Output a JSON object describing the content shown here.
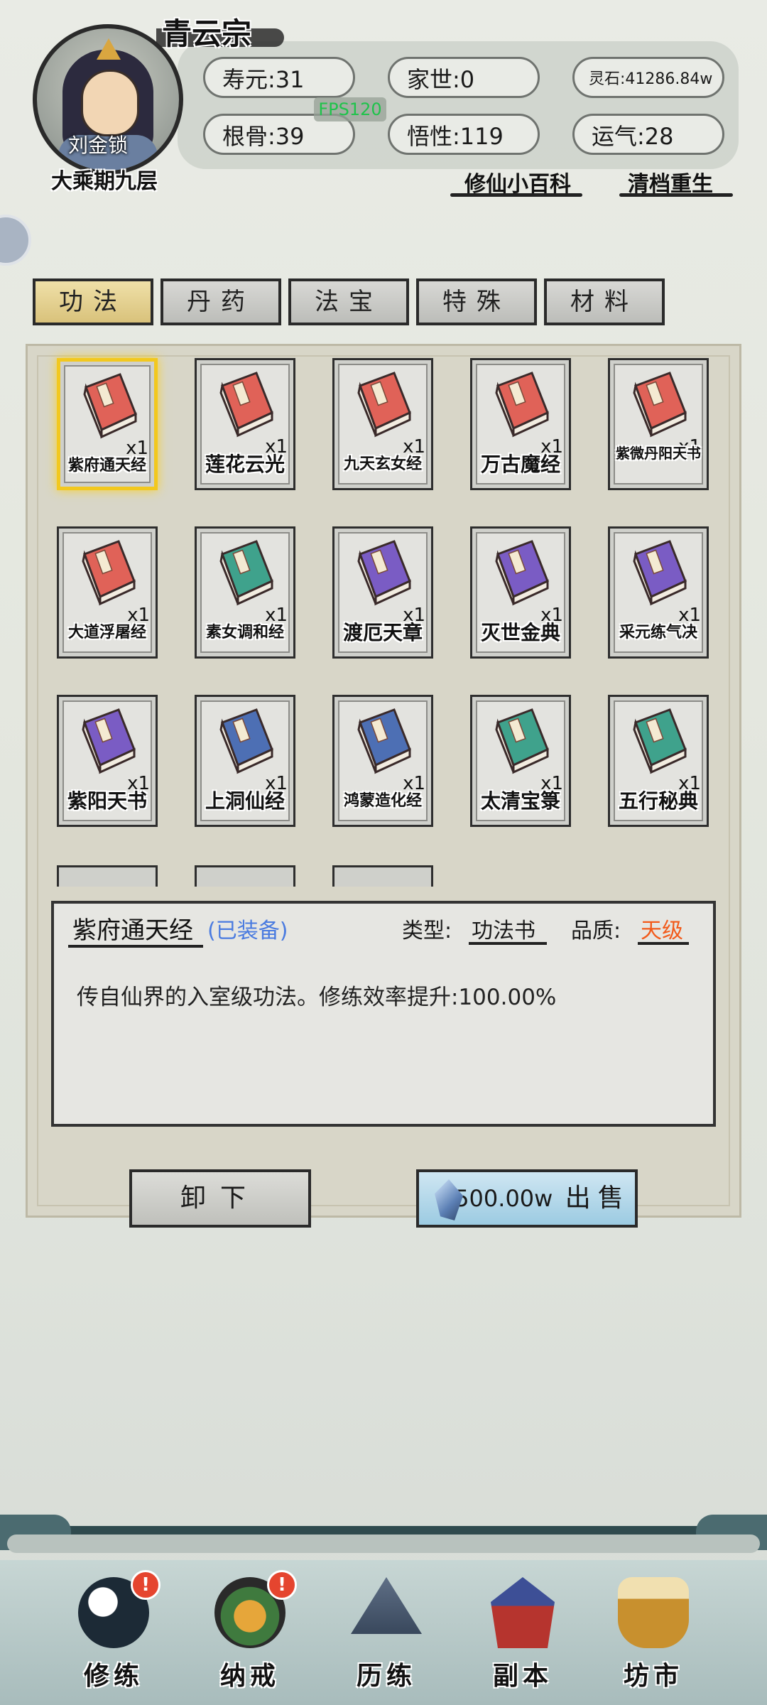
{
  "header": {
    "sect": "青云宗",
    "character": {
      "name": "刘金锁",
      "rank": "大乘期九层"
    },
    "stats": [
      {
        "label": "寿元:",
        "value": "31"
      },
      {
        "label": "家世:",
        "value": "0"
      },
      {
        "label": "灵石:",
        "value": "41286.84w"
      },
      {
        "label": "根骨:",
        "value": "39"
      },
      {
        "label": "悟性:",
        "value": "119"
      },
      {
        "label": "运气:",
        "value": "28"
      }
    ],
    "fps": "FPS120",
    "links": {
      "encyclopedia": "修仙小百科",
      "reset": "清档重生"
    }
  },
  "tabs": [
    "功法",
    "丹药",
    "法宝",
    "特殊",
    "材料"
  ],
  "items": [
    {
      "name": "紫府通天经",
      "qty": "x1",
      "color": "#e06258"
    },
    {
      "name": "莲花云光",
      "qty": "x1",
      "color": "#e06258"
    },
    {
      "name": "九天玄女经",
      "qty": "x1",
      "color": "#e06258"
    },
    {
      "name": "万古魔经",
      "qty": "x1",
      "color": "#e06258"
    },
    {
      "name": "紫微丹阳天书",
      "qty": "x1",
      "color": "#e06258"
    },
    {
      "name": "大道浮屠经",
      "qty": "x1",
      "color": "#e06258"
    },
    {
      "name": "素女调和经",
      "qty": "x1",
      "color": "#3fa28c"
    },
    {
      "name": "渡厄天章",
      "qty": "x1",
      "color": "#7a5cc4"
    },
    {
      "name": "灭世金典",
      "qty": "x1",
      "color": "#7a5cc4"
    },
    {
      "name": "采元练气决",
      "qty": "x1",
      "color": "#7a5cc4"
    },
    {
      "name": "紫阳天书",
      "qty": "x1",
      "color": "#7a5cc4"
    },
    {
      "name": "上洞仙经",
      "qty": "x1",
      "color": "#4d6fb4"
    },
    {
      "name": "鸿蒙造化经",
      "qty": "x1",
      "color": "#4d6fb4"
    },
    {
      "name": "太清宝箓",
      "qty": "x1",
      "color": "#3fa28c"
    },
    {
      "name": "五行秘典",
      "qty": "x1",
      "color": "#3fa28c"
    }
  ],
  "detail": {
    "name": "紫府通天经",
    "equipped": "(已装备)",
    "type_label": "类型:",
    "type_value": "功法书",
    "quality_label": "品质:",
    "quality_value": "天级",
    "description": "传自仙界的入室级功法。修练效率提升:100.00%",
    "quality_color": "#f25a1a"
  },
  "buttons": {
    "unequip": "卸下",
    "sell_price": "500.00w",
    "sell": "出售"
  },
  "nav": [
    {
      "label": "修练",
      "badge": "!"
    },
    {
      "label": "纳戒",
      "badge": "!"
    },
    {
      "label": "历练"
    },
    {
      "label": "副本"
    },
    {
      "label": "坊市"
    }
  ]
}
